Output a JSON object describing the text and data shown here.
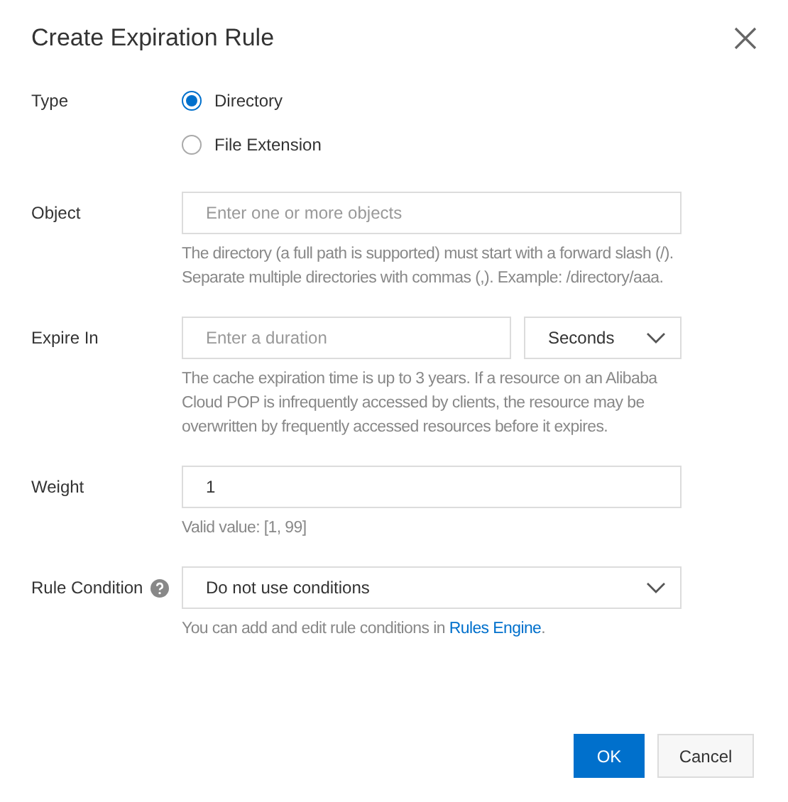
{
  "dialog": {
    "title": "Create Expiration Rule"
  },
  "fields": [
    {
      "kind": "radio",
      "label": "Type",
      "options": [
        {
          "label": "Directory",
          "selected": true
        },
        {
          "label": "File Extension",
          "selected": false
        }
      ]
    },
    {
      "kind": "input",
      "label": "Object",
      "placeholder": "Enter one or more objects",
      "help": "The directory (a full path is supported) must start with a forward slash (/). Separate multiple directories with commas (,). Example: /directory/aaa."
    },
    {
      "kind": "input-select",
      "label": "Expire In",
      "placeholder": "Enter a duration",
      "select": "Seconds",
      "help": "The cache expiration time is up to 3 years. If a resource on an Alibaba Cloud POP is infrequently accessed by clients, the resource may be overwritten by frequently accessed resources before it expires."
    },
    {
      "kind": "input",
      "label": "Weight",
      "value": "1",
      "help": "Valid value: [1, 99]"
    },
    {
      "kind": "select",
      "label": "Rule Condition",
      "info": true,
      "select": "Do not use conditions",
      "help": "You can add and edit rule conditions in ",
      "link": "Rules Engine",
      "help_end": "."
    }
  ],
  "buttons": [
    {
      "label": "OK",
      "kind": "primary"
    },
    {
      "label": "Cancel",
      "kind": "secondary"
    }
  ]
}
